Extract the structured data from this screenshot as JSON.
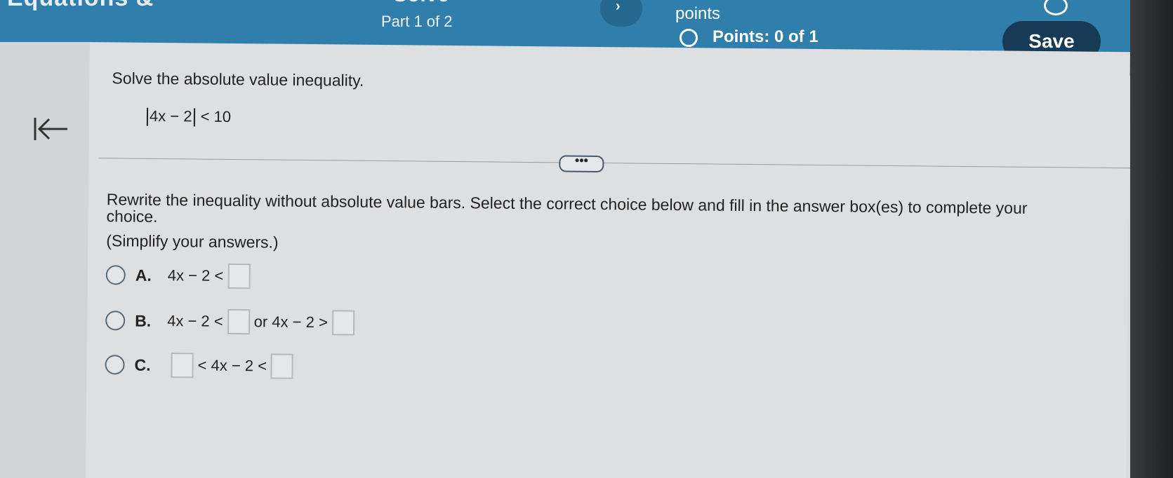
{
  "header": {
    "cut_title": "Equations &",
    "cut_solve": "Solve",
    "part_label": "Part 1 of 2",
    "nav_arrow": "›",
    "points_label": "points",
    "points_status": "Points: 0 of 1",
    "save_label": "Save"
  },
  "question": {
    "title": "Solve the absolute value inequality.",
    "expr_inner": "4x − 2",
    "expr_rhs": "< 10",
    "more_label": "•••",
    "instruction": "Rewrite the inequality without absolute value bars. Select the correct choice below and fill in the answer box(es) to complete your choice.",
    "simplify": "(Simplify your answers.)"
  },
  "choices": {
    "a": {
      "letter": "A.",
      "lhs": "4x − 2 <"
    },
    "b": {
      "letter": "B.",
      "lhs": "4x − 2 <",
      "mid": "or 4x − 2 >"
    },
    "c": {
      "letter": "C.",
      "mid": "< 4x − 2 <"
    }
  },
  "icons": {
    "back": "collapse-left-icon",
    "gear": "settings-icon",
    "status": "circle-outline-icon"
  },
  "colors": {
    "header_blue": "#2f7eab",
    "save_button": "#173a55"
  }
}
